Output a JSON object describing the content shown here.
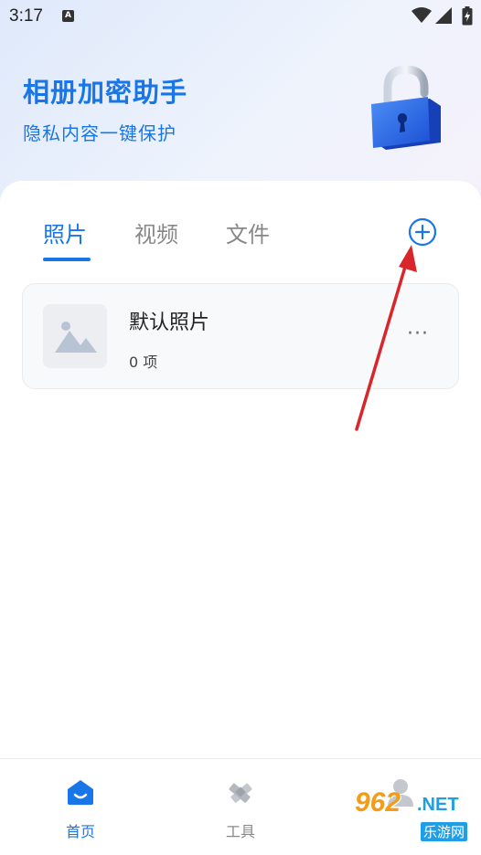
{
  "status_bar": {
    "time": "3:17",
    "notification_letter": "A"
  },
  "header": {
    "title": "相册加密助手",
    "subtitle": "隐私内容一键保护"
  },
  "tabs": [
    {
      "label": "照片",
      "active": true
    },
    {
      "label": "视频",
      "active": false
    },
    {
      "label": "文件",
      "active": false
    }
  ],
  "album": {
    "name": "默认照片",
    "count": "0 项",
    "more": "···"
  },
  "bottom_nav": [
    {
      "label": "首页",
      "icon": "home-icon",
      "active": true
    },
    {
      "label": "工具",
      "icon": "tools-icon",
      "active": false
    },
    {
      "label": "",
      "icon": "profile-icon",
      "active": false
    }
  ],
  "watermark": {
    "brand": "962",
    "domain": ".NET",
    "site": "乐游网"
  },
  "colors": {
    "accent": "#1976e8",
    "annotation": "#d8262b"
  }
}
